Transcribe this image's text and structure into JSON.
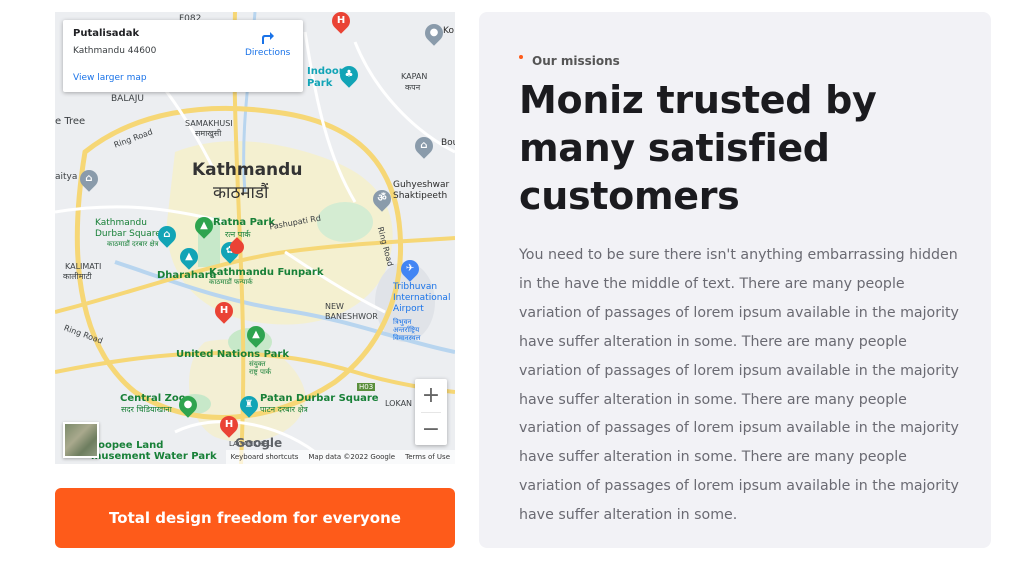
{
  "map": {
    "card": {
      "place_name": "Putalisadak",
      "address": "Kathmandu 44600",
      "directions_label": "Directions",
      "view_larger_label": "View larger map"
    },
    "labels": {
      "road_f082": "F082",
      "balaju": "BALAJU",
      "tree": "e Tree",
      "samakhusi": "SAMAKHUSI",
      "samakhusi_ne": "समाखुसी",
      "ring_road_1": "Ring Road",
      "ring_road_2": "Ring Road",
      "ring_road_3": "Ring Road",
      "kathmandu": "Kathmandu",
      "kathmandu_ne": "काठमाडौं",
      "aitya": "aitya",
      "ratna_park": "Ratna Park",
      "ratna_park_ne": "रत्न पार्क",
      "pashupati_rd": "Pashupati Rd",
      "durbar_square": "Kathmandu\nDurbar Square",
      "durbar_square_ne": "काठमाडौं दरबार क्षेत्र",
      "kalimati": "KALIMATI",
      "kalimati_ne": "कालीमाटी",
      "dharahara": "Dharahara",
      "funpark": "Kathmandu Funpark",
      "funpark_ne": "काठमाडौं फन्पार्क",
      "guhyeshwari": "Guhyeshwar\nShaktipeeth",
      "tribhuvan": "Tribhuvan\nInternational\nAirport",
      "tribhuvan_ne": "त्रिभुवन\nअन्तर्राष्ट्रिय\nविमानस्थल",
      "new_baneshwor": "NEW\nBANESHWOR",
      "un_park": "United Nations Park",
      "un_park_ne": "संयुक्त\nराष्ट्र पार्क",
      "h03": "H03",
      "central_zoo": "Central Zoo",
      "central_zoo_ne": "सदर चिडियाखाना",
      "patan": "Patan Durbar Square",
      "patan_ne": "पाटन दरबार क्षेत्र",
      "lokan": "LOKAN",
      "lagan": "LAGANKHEL",
      "bhoopee": "hoopee Land\nmusement Water Park",
      "indoor": "Indoor\nPark",
      "kapan": "KAPAN",
      "kapan_ne": "कपन",
      "bouddha": "Bou",
      "ko": "Ko"
    },
    "google_logo": "Google",
    "attribution": {
      "shortcuts": "Keyboard shortcuts",
      "map_data": "Map data ©2022 Google",
      "terms": "Terms of Use"
    },
    "zoom_in": "+",
    "zoom_out": "−"
  },
  "cta": {
    "label": "Total design freedom for everyone"
  },
  "mission": {
    "tag": "Our missions",
    "heading": "Moniz trusted by many satisfied customers",
    "body": "You need to be sure there isn't anything embarrassing hidden in the have the middle of text. There are many people variation of passages of lorem ipsum available in the majority have suffer alteration in some. There are many people variation of passages of lorem ipsum available in the majority have suffer alteration in some. There are many people variation of passages of lorem ipsum available in the majority have suffer alteration in some. There are many people variation of passages of lorem ipsum available in the majority have suffer alteration in some."
  },
  "colors": {
    "accent": "#fe5b1a",
    "panel_bg": "#f2f2f6",
    "heading": "#1b1b1f",
    "body_text": "#6a6a72"
  }
}
